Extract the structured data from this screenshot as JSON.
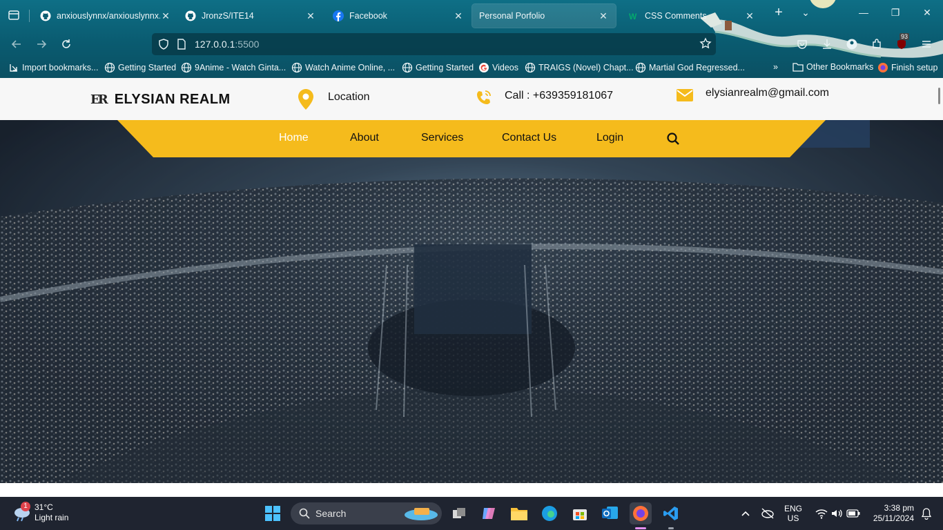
{
  "browser": {
    "tabs": [
      {
        "label": "anxiouslynnx/anxiouslynnx.g",
        "icon": "github-icon"
      },
      {
        "label": "JronzS/ITE14",
        "icon": "github-icon"
      },
      {
        "label": "Facebook",
        "icon": "facebook-icon"
      },
      {
        "label": "Personal Porfolio",
        "icon": "none",
        "active": true
      },
      {
        "label": "CSS Comments",
        "icon": "w3schools-icon"
      }
    ],
    "url": {
      "host": "127.0.0.1",
      "port": ":5500"
    },
    "bookmarks": [
      {
        "label": "Import bookmarks...",
        "icon": "import-icon"
      },
      {
        "label": "Getting Started",
        "icon": "globe-icon"
      },
      {
        "label": "9Anime - Watch Ginta...",
        "icon": "globe-icon"
      },
      {
        "label": "Watch Anime Online, ...",
        "icon": "globe-icon"
      },
      {
        "label": "Getting Started",
        "icon": "globe-icon"
      },
      {
        "label": "Videos",
        "icon": "google-icon"
      },
      {
        "label": "TRAIGS (Novel) Chapt...",
        "icon": "globe-icon"
      },
      {
        "label": "Martial God Regressed...",
        "icon": "globe-icon"
      }
    ],
    "other_bookmarks": "Other Bookmarks",
    "finish_setup": "Finish setup",
    "extension_badge": "93"
  },
  "site": {
    "logo_mark": "ER",
    "brand": "ELYSIAN REALM",
    "location": "Location",
    "phone": "Call : +639359181067",
    "email": "elysianrealm@gmail.com",
    "menu": [
      "Home",
      "About",
      "Services",
      "Contact Us",
      "Login"
    ],
    "accent": "#f5bb1c"
  },
  "taskbar": {
    "weather_temp": "31°C",
    "weather_desc": "Light rain",
    "weather_badge": "1",
    "search_placeholder": "Search",
    "lang_top": "ENG",
    "lang_bottom": "US",
    "time": "3:38 pm",
    "date": "25/11/2024"
  }
}
